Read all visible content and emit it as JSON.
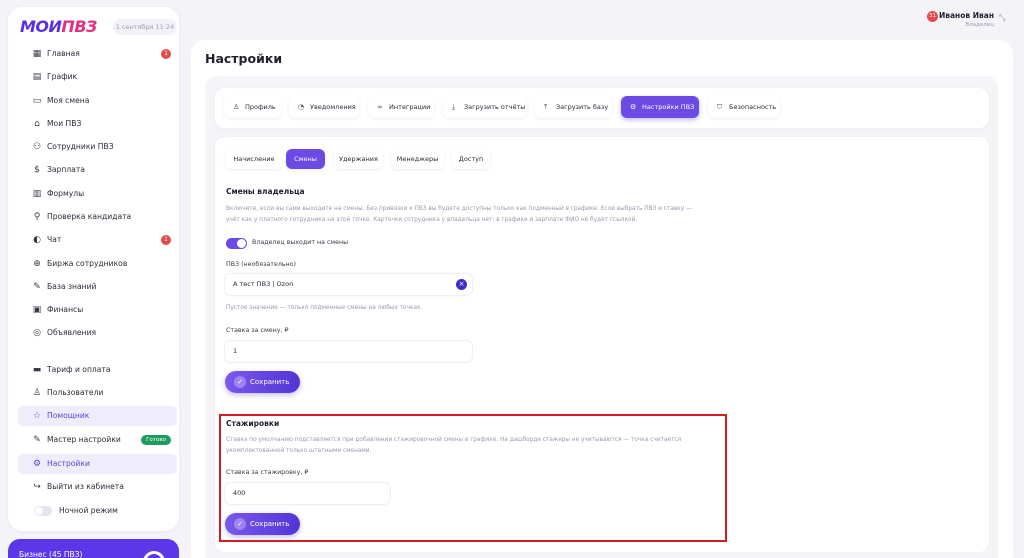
{
  "brand": {
    "logo_part1": "МОИ",
    "logo_part2": "ПВЗ",
    "date": "1 сентября 11:24"
  },
  "sidebar": {
    "items": [
      {
        "label": "Главная",
        "icon": "grid-icon",
        "badge": "1"
      },
      {
        "label": "График",
        "icon": "calendar-icon"
      },
      {
        "label": "Моя смена",
        "icon": "briefcase-icon"
      },
      {
        "label": "Мои ПВЗ",
        "icon": "store-icon"
      },
      {
        "label": "Сотрудники ПВЗ",
        "icon": "users-icon"
      },
      {
        "label": "Зарплата",
        "icon": "dollar-icon"
      },
      {
        "label": "Формулы",
        "icon": "formula-icon"
      },
      {
        "label": "Проверка кандидата",
        "icon": "search-user-icon"
      },
      {
        "label": "Чат",
        "icon": "chat-icon",
        "badge": "1"
      },
      {
        "label": "Биржа сотрудников",
        "icon": "globe-icon"
      },
      {
        "label": "База знаний",
        "icon": "book-icon"
      },
      {
        "label": "Финансы",
        "icon": "wallet-icon"
      },
      {
        "label": "Объявления",
        "icon": "megaphone-icon"
      }
    ],
    "items2": [
      {
        "label": "Тариф и оплата",
        "icon": "card-icon"
      },
      {
        "label": "Пользователи",
        "icon": "user-icon"
      },
      {
        "label": "Помощник",
        "icon": "star-icon"
      },
      {
        "label": "Мастер настройки",
        "icon": "wand-icon",
        "done": "Готово"
      },
      {
        "label": "Настройки",
        "icon": "gear-icon"
      },
      {
        "label": "Выйти из кабинета",
        "icon": "logout-icon"
      },
      {
        "label": "Ночной режим",
        "icon": "moon-icon"
      }
    ],
    "plan": "Бизнес (45 ПВЗ)"
  },
  "user": {
    "name": "Иванов Иван",
    "role": "Владелец",
    "notifications": "31"
  },
  "page": {
    "title": "Настройки",
    "tabs": [
      {
        "label": "Профиль",
        "icon": "user-icon"
      },
      {
        "label": "Уведомления",
        "icon": "bell-icon"
      },
      {
        "label": "Интеграции",
        "icon": "link-icon"
      },
      {
        "label": "Загрузить отчёты",
        "icon": "download-icon"
      },
      {
        "label": "Загрузить базу",
        "icon": "upload-icon"
      },
      {
        "label": "Настройки ПВЗ",
        "icon": "gear-icon"
      },
      {
        "label": "Безопасность",
        "icon": "shield-icon"
      }
    ],
    "subtabs": [
      "Начисление",
      "Смены",
      "Удержания",
      "Менеджеры",
      "Доступ"
    ]
  },
  "owner_shifts": {
    "title": "Смены владельца",
    "desc1": "Включите, если вы сами выходите на смены. Без привязки к ПВЗ вы будете доступны только как подменный в графике. Если выбрать ПВЗ и ставку —",
    "desc2": "учёт как у платного сотрудника на этой точке. Карточки сотрудника у владельца нет: в графике и зарплате ФИО не будет ссылкой.",
    "toggle_label": "Владелец выходит на смены",
    "pvz_label": "ПВЗ (необязательно)",
    "pvz_value": "А тест ПВЗ | Ozon",
    "pvz_hint": "Пустое значение — только подменные смены на любых точках.",
    "rate_label": "Ставка за смену, ₽",
    "rate_value": "1",
    "save": "Сохранить"
  },
  "internships": {
    "title": "Стажировки",
    "desc1": "Ставка по умолчанию подставляется при добавлении стажировочной смены в графике. На дашборде стажеры не учитываются — точка считается",
    "desc2": "укомплектованной только штатными сменами.",
    "rate_label": "Ставка за стажировку, ₽",
    "rate_value": "400",
    "save": "Сохранить"
  }
}
